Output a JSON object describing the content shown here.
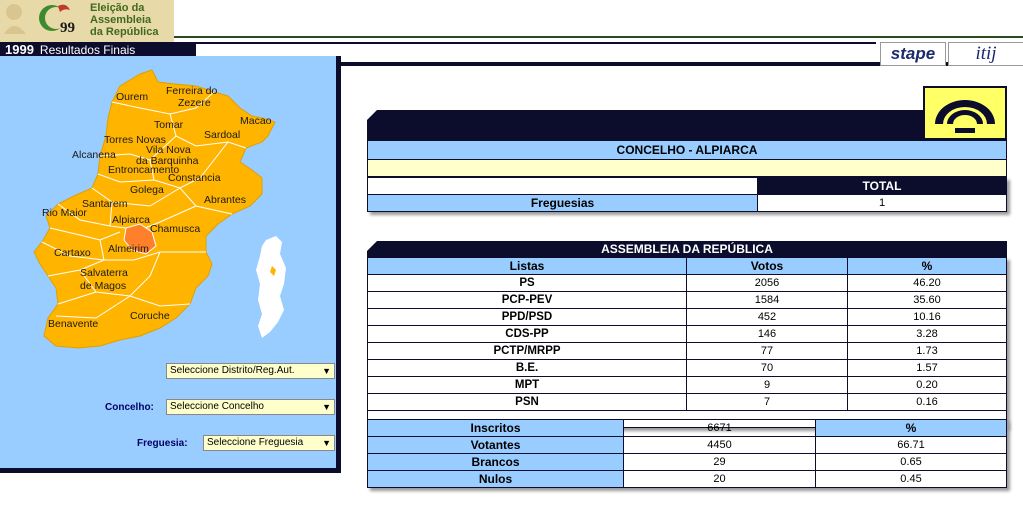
{
  "header": {
    "title_lines": [
      "Eleição da",
      "Assembleia",
      "da República"
    ],
    "emblem_text": "99",
    "year": "1999",
    "subtitle": "Resultados Finais",
    "logo_stape": "stape",
    "logo_itij": "itij"
  },
  "map": {
    "towns": [
      "Ourem",
      "Ferreira do",
      "Zezere",
      "Tomar",
      "Macao",
      "Sardoal",
      "Torres Novas",
      "Vila Nova",
      "da Barquinha",
      "Alcanena",
      "Entroncamento",
      "Constancia",
      "Golega",
      "Abrantes",
      "Santarem",
      "Rio Maior",
      "Alpiarca",
      "Chamusca",
      "Almeirim",
      "Cartaxo",
      "Salvaterra",
      "de Magos",
      "Coruche",
      "Benavente"
    ],
    "highlighted": "Alpiarca",
    "colors": {
      "region": "#ffb400",
      "highlight": "#ff7f2a",
      "border": "#ffffff",
      "portugal": "#ffffff",
      "background": "#99ccff"
    }
  },
  "selectors": {
    "distrito": {
      "label": "",
      "value": "Seleccione Distrito/Reg.Aut."
    },
    "concelho": {
      "label": "Concelho:",
      "value": "Seleccione Concelho"
    },
    "freguesia": {
      "label": "Freguesia:",
      "value": "Seleccione Freguesia"
    }
  },
  "concelho": {
    "title": "CONCELHO - ALPIARCA",
    "total_label": "TOTAL",
    "freguesias_label": "Freguesias",
    "freguesias_value": "1"
  },
  "assembleia": {
    "title": "ASSEMBLEIA DA REPÚBLICA",
    "columns": [
      "Listas",
      "Votos",
      "%"
    ],
    "rows": [
      {
        "lista": "PS",
        "votos": "2056",
        "pct": "46.20"
      },
      {
        "lista": "PCP-PEV",
        "votos": "1584",
        "pct": "35.60"
      },
      {
        "lista": "PPD/PSD",
        "votos": "452",
        "pct": "10.16"
      },
      {
        "lista": "CDS-PP",
        "votos": "146",
        "pct": "3.28"
      },
      {
        "lista": "PCTP/MRPP",
        "votos": "77",
        "pct": "1.73"
      },
      {
        "lista": "B.E.",
        "votos": "70",
        "pct": "1.57"
      },
      {
        "lista": "MPT",
        "votos": "9",
        "pct": "0.20"
      },
      {
        "lista": "PSN",
        "votos": "7",
        "pct": "0.16"
      }
    ]
  },
  "summary": {
    "rows": [
      {
        "label": "Inscritos",
        "value": "6671",
        "pct": "%"
      },
      {
        "label": "Votantes",
        "value": "4450",
        "pct": "66.71"
      },
      {
        "label": "Brancos",
        "value": "29",
        "pct": "0.65"
      },
      {
        "label": "Nulos",
        "value": "20",
        "pct": "0.45"
      }
    ]
  }
}
